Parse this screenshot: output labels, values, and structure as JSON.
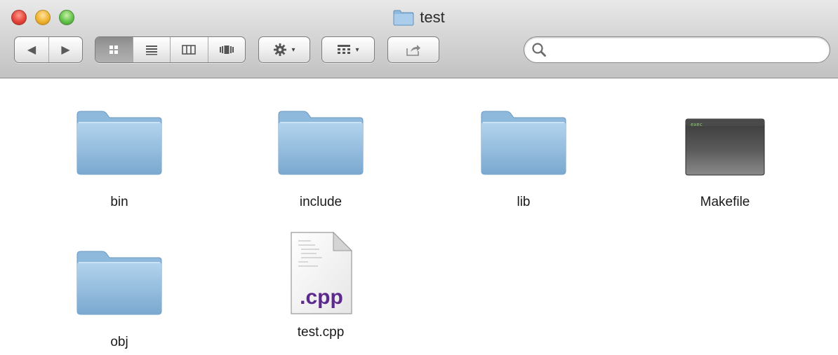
{
  "window": {
    "title": "test"
  },
  "toolbar": {
    "nav": {
      "back_glyph": "◀",
      "forward_glyph": "▶"
    },
    "views": {
      "selected": "icon-view"
    },
    "action_caret": "▾",
    "arrange_caret": "▾"
  },
  "search": {
    "value": "",
    "placeholder": ""
  },
  "files": [
    {
      "name": "bin",
      "kind": "folder"
    },
    {
      "name": "include",
      "kind": "folder"
    },
    {
      "name": "lib",
      "kind": "folder"
    },
    {
      "name": "Makefile",
      "kind": "exec",
      "badge": "exec"
    },
    {
      "name": "obj",
      "kind": "folder"
    },
    {
      "name": "test.cpp",
      "kind": "source",
      "ext": ".cpp"
    }
  ],
  "colors": {
    "folder_top": "#9fc6e4",
    "folder_bottom": "#6f9fc8",
    "exec_badge": "#7adf5a",
    "cpp_ext": "#5b2a8c"
  }
}
